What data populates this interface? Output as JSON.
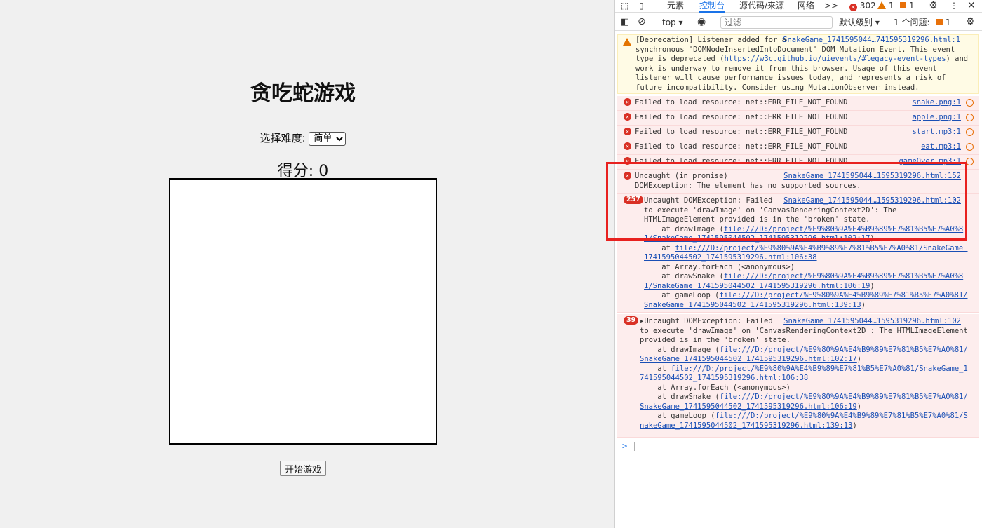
{
  "page": {
    "title": "贪吃蛇游戏",
    "difficulty_label": "选择难度:",
    "difficulty_value": "简单",
    "score_text": "得分: 0",
    "start_button": "开始游戏"
  },
  "devtools": {
    "tabs": [
      "元素",
      "控制台",
      "源代码/来源",
      "网络"
    ],
    "active_tab": "控制台",
    "more_tabs": ">>",
    "error_count": "302",
    "warning_count": "1",
    "issue_count": "1",
    "toolbar": {
      "context": "top",
      "filter_placeholder": "过滤",
      "levels": "默认级别",
      "issues_label": "1 个问题:",
      "issues_count": "1"
    },
    "messages": {
      "warn": {
        "lines": [
          "[Deprecation] Listener added for a ",
          "synchronous 'DOMNodeInsertedIntoDocument' DOM Mutation Event. This event",
          "type is deprecated (",
          ") and",
          "work is underway to remove it from this browser. Usage of this event",
          "listener will cause performance issues today, and represents a risk of",
          "future incompatibility. Consider using MutationObserver instead."
        ],
        "source": "SnakeGame_1741595044…741595319296.html:1",
        "link": "https://w3c.github.io/uievents/#legacy-event-types"
      },
      "failed": [
        {
          "text": "Failed to load resource: net::ERR_FILE_NOT_FOUND",
          "source": "snake.png:1"
        },
        {
          "text": "Failed to load resource: net::ERR_FILE_NOT_FOUND",
          "source": "apple.png:1"
        },
        {
          "text": "Failed to load resource: net::ERR_FILE_NOT_FOUND",
          "source": "start.mp3:1"
        },
        {
          "text": "Failed to load resource: net::ERR_FILE_NOT_FOUND",
          "source": "eat.mp3:1"
        },
        {
          "text": "Failed to load resource: net::ERR_FILE_NOT_FOUND",
          "source": "gameOver.mp3:1"
        }
      ],
      "promise": {
        "line1": "Uncaught (in promise)",
        "line2": "DOMException: The element has no supported sources.",
        "source": "SnakeGame_1741595044…1595319296.html:152"
      },
      "dom1": {
        "count": "257",
        "line1": "Uncaught DOMException: Failed",
        "line2": "to execute 'drawImage' on 'CanvasRenderingContext2D': The",
        "line3": "HTMLImageElement provided is in the 'broken' state.",
        "source": "SnakeGame_1741595044…1595319296.html:102",
        "stack": [
          "    at drawImage (",
          "file:///D:/project/%E9%80%9A%E4%B9%89%E7%81%B5%E7%A0%8",
          "1/SnakeGame_1741595044502_1741595319296.html:102:17",
          ")",
          "    at ",
          "file:///D:/project/%E9%80%9A%E4%B9%89%E7%81%B5%E7%A0%81/SnakeGame_",
          "1741595044502_1741595319296.html:106:38",
          "    at Array.forEach (<anonymous>)",
          "    at drawSnake (",
          "file:///D:/project/%E9%80%9A%E4%B9%89%E7%81%B5%E7%A0%8",
          "1/SnakeGame_1741595044502_1741595319296.html:106:19",
          ")",
          "    at gameLoop (",
          "file:///D:/project/%E9%80%9A%E4%B9%89%E7%81%B5%E7%A0%81/",
          "SnakeGame_1741595044502_1741595319296.html:139:13",
          ")"
        ]
      },
      "dom2": {
        "count": "39",
        "line1": "Uncaught DOMException: Failed",
        "line2": "to execute 'drawImage' on 'CanvasRenderingContext2D': The HTMLImageElement",
        "line3": "provided is in the 'broken' state.",
        "source": "SnakeGame_1741595044…1595319296.html:102",
        "stack": [
          "    at drawImage (",
          "file:///D:/project/%E9%80%9A%E4%B9%89%E7%81%B5%E7%A0%81/",
          "SnakeGame_1741595044502_1741595319296.html:102:17",
          ")",
          "    at ",
          "file:///D:/project/%E9%80%9A%E4%B9%89%E7%81%B5%E7%A0%81/SnakeGame_1",
          "741595044502_1741595319296.html:106:38",
          "    at Array.forEach (<anonymous>)",
          "    at drawSnake (",
          "file:///D:/project/%E9%80%9A%E4%B9%89%E7%81%B5%E7%A0%81/",
          "SnakeGame_1741595044502_1741595319296.html:106:19",
          ")",
          "    at gameLoop (",
          "file:///D:/project/%E9%80%9A%E4%B9%89%E7%81%B5%E7%A0%81/S",
          "nakeGame_1741595044502_1741595319296.html:139:13",
          ")"
        ]
      }
    },
    "prompt": ">",
    "colors": {
      "accent": "#1a73e8",
      "error": "#d93025",
      "highlight": "#e8211f"
    }
  }
}
